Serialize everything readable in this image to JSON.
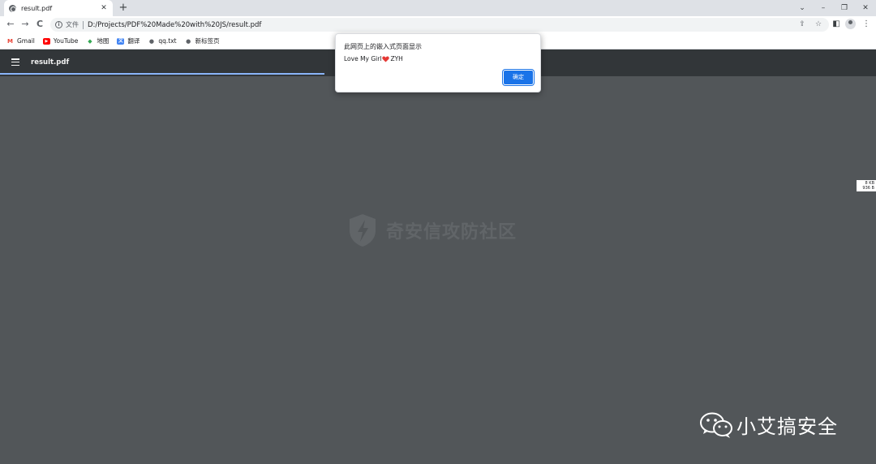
{
  "tab": {
    "title": "result.pdf",
    "close": "✕",
    "new_tab": "+"
  },
  "window_controls": {
    "dropdown": "⌄",
    "minimize": "–",
    "restore": "❐",
    "close": "✕"
  },
  "toolbar": {
    "back": "←",
    "forward": "→",
    "reload": "C",
    "scheme_label": "文件",
    "url": "D:/Projects/PDF%20Made%20with%20JS/result.pdf",
    "share": "⇪",
    "star": "☆",
    "side_panel": "◧",
    "menu": "⋮"
  },
  "bookmarks": [
    {
      "label": "Gmail",
      "icon": "gmail-icon",
      "color": "#ea4335",
      "glyph": "M"
    },
    {
      "label": "YouTube",
      "icon": "youtube-icon",
      "color": "#ff0000",
      "glyph": "▶"
    },
    {
      "label": "地图",
      "icon": "maps-icon",
      "color": "#34a853",
      "glyph": "◆"
    },
    {
      "label": "翻译",
      "icon": "translate-icon",
      "color": "#4285f4",
      "glyph": "文"
    },
    {
      "label": "qq.txt",
      "icon": "globe-icon",
      "color": "#5f6368",
      "glyph": "●"
    },
    {
      "label": "新标签页",
      "icon": "globe-icon",
      "color": "#5f6368",
      "glyph": "●"
    }
  ],
  "pdf_viewer": {
    "title": "result.pdf",
    "progress": 0.37
  },
  "dialog": {
    "title": "此网页上的嵌入式页面显示",
    "message_before": "Love My Girl",
    "message_after": "ZYH",
    "ok_label": "确定"
  },
  "side_label": {
    "line1": "8 KB",
    "line2": "936 B"
  },
  "watermarks": {
    "center": "奇安信攻防社区",
    "bottom_right": "小艾搞安全"
  },
  "colors": {
    "accent": "#1a73e8",
    "pdf_toolbar": "#323639",
    "viewer_bg": "#525659",
    "progress": "#8ab4f8",
    "heart": "#e53935"
  }
}
